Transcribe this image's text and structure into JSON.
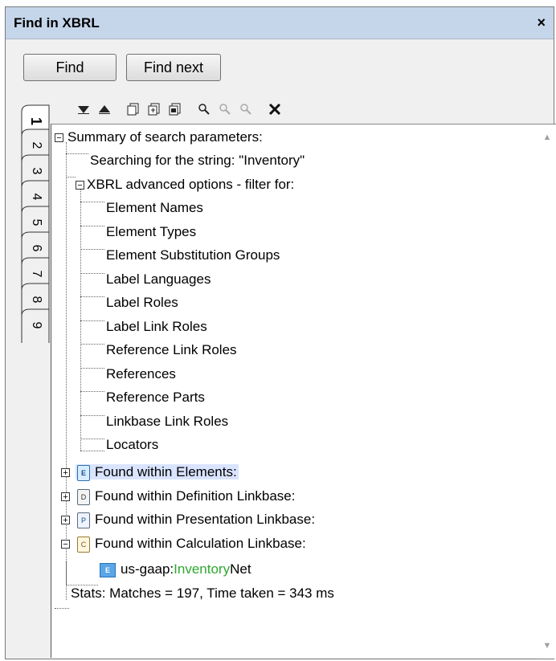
{
  "window": {
    "title": "Find in XBRL",
    "close_glyph": "×"
  },
  "buttons": {
    "find": "Find",
    "find_next": "Find next"
  },
  "tabs": [
    "1",
    "2",
    "3",
    "4",
    "5",
    "6",
    "7",
    "8",
    "9"
  ],
  "active_tab": "1",
  "toolbar": {
    "icons": [
      "next-result-icon",
      "previous-result-icon",
      "copy-message-icon",
      "copy-message-with-children-icon",
      "copy-all-messages-icon",
      "find-icon",
      "find-previous-icon",
      "find-next-icon",
      "clear-icon"
    ]
  },
  "tree": {
    "summary": "Summary of search parameters:",
    "searching": "Searching for the string: \"Inventory\"",
    "advanced": "XBRL advanced options - filter for:",
    "filters": [
      "Element Names",
      "Element Types",
      "Element Substitution Groups",
      "Label Languages",
      "Label Roles",
      "Label Link Roles",
      "Reference Link Roles",
      "References",
      "Reference Parts",
      "Linkbase Link Roles",
      "Locators"
    ],
    "found_elements": "Found within Elements:",
    "found_definition": "Found within Definition Linkbase:",
    "found_presentation": "Found within Presentation Linkbase:",
    "found_calculation": "Found within Calculation Linkbase:",
    "result_prefix": "us-gaap:",
    "result_match": "Inventory",
    "result_suffix": "Net",
    "stats": "Stats: Matches = 197, Time taken = 343 ms",
    "icon_letters": {
      "elements": "E",
      "definition": "D",
      "presentation": "P",
      "calculation": "C",
      "result": "E"
    }
  },
  "colors": {
    "title_bar": "#c6d6ea",
    "highlight": "#d9e4ff",
    "match_text": "#2fa82f"
  }
}
